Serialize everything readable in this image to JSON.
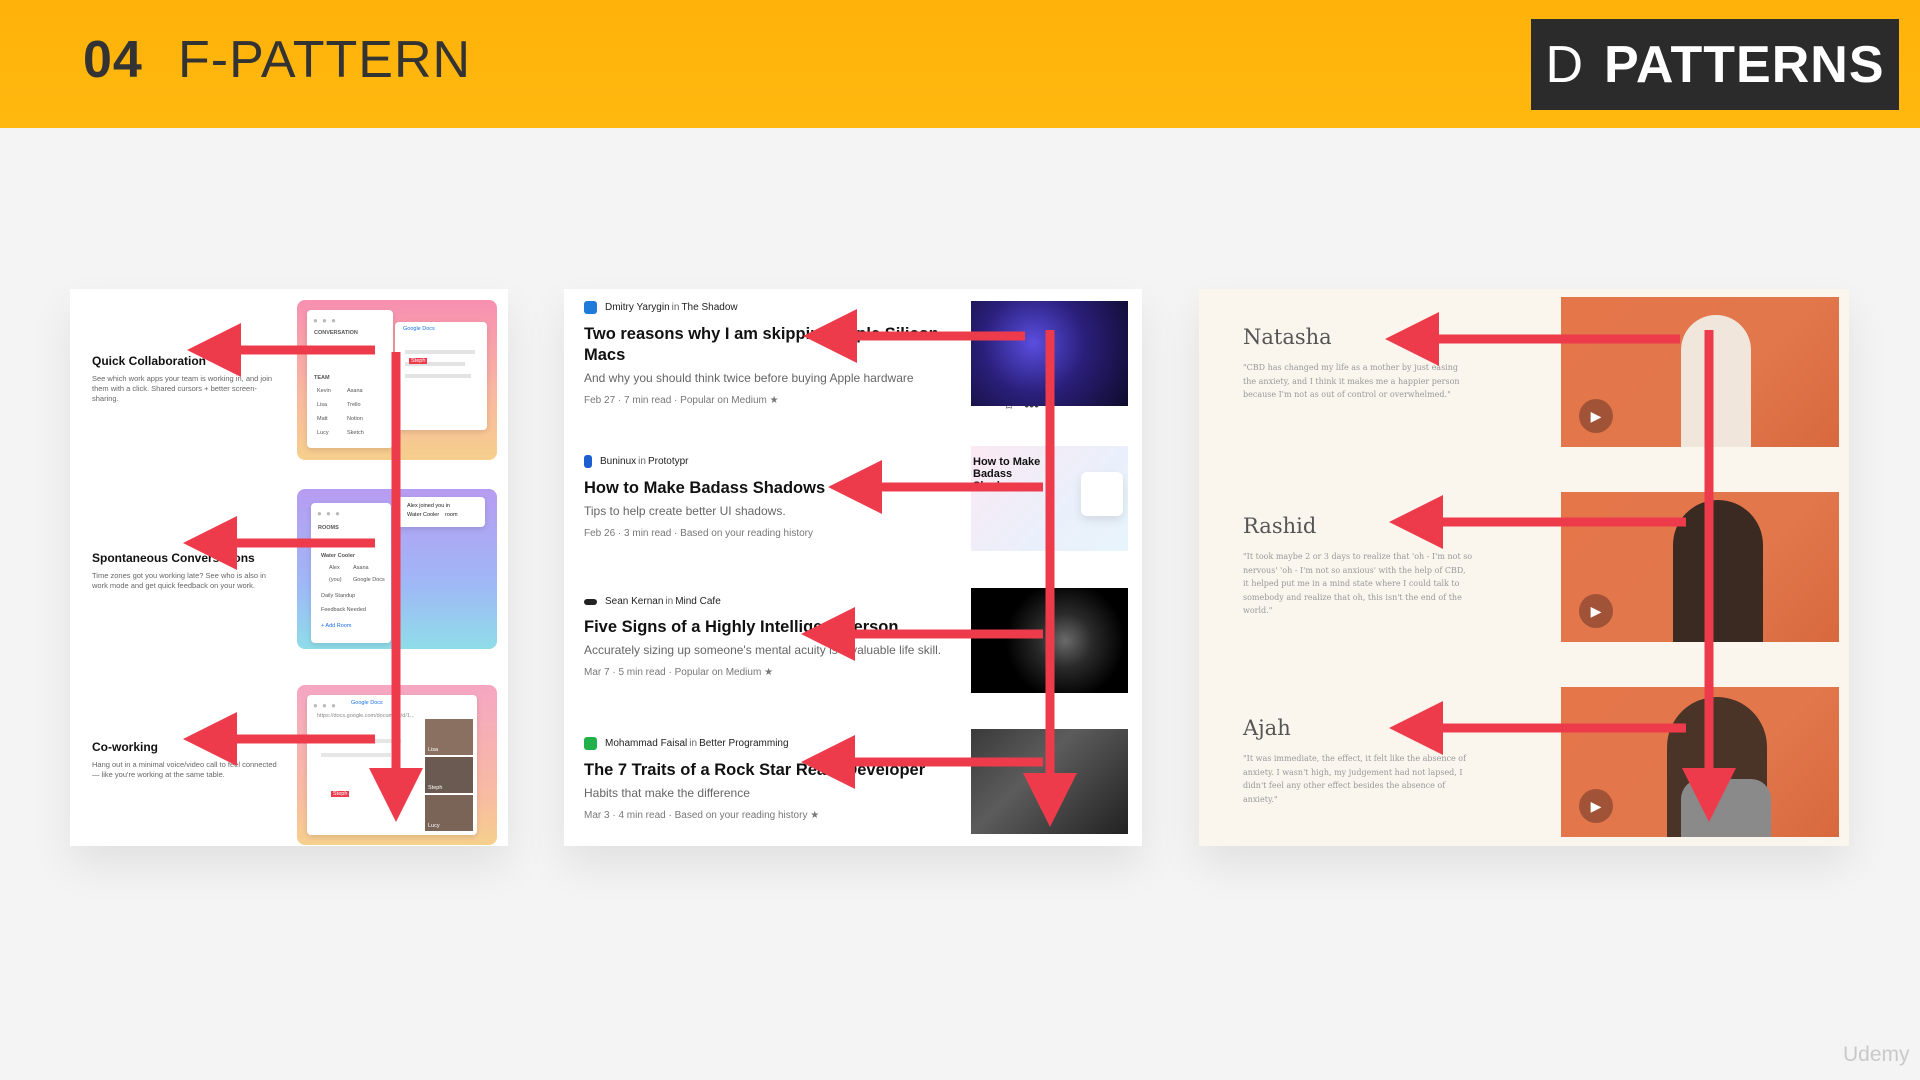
{
  "header": {
    "number": "04",
    "title": "F-PATTERN",
    "brand_d": "D",
    "brand_word": "PATTERNS"
  },
  "watermark": "Udemy",
  "panel1": {
    "features": [
      {
        "title": "Quick Collaboration",
        "text": "See which work apps your team is working in, and join them with a click. Shared cursors + better screen-sharing."
      },
      {
        "title": "Spontaneous Conversations",
        "text": "Time zones got you working late? See who is also in work mode and get quick feedback on your work."
      },
      {
        "title": "Co-working",
        "text": "Hang out in a minimal voice/video call to feel connected — like you're working at the same table."
      }
    ],
    "shot1": {
      "section": "CONVERSATION",
      "you": "(you)",
      "team_label": "TEAM",
      "team": [
        "Kevin",
        "Lisa",
        "Matt",
        "Lucy"
      ],
      "apps": [
        "Asana",
        "Trello",
        "Notion",
        "Sketch"
      ],
      "tab": "Google Docs",
      "cursor": "Steph"
    },
    "shot2": {
      "section": "ROOMS",
      "toast_line1": "Alex joined you in",
      "toast_line2": "Water Cooler",
      "toast_line3": "room",
      "rooms": [
        "Good Morning",
        "Water Cooler",
        "Daily Standup",
        "Feedback Needed"
      ],
      "members": [
        "Alex",
        "(you)"
      ],
      "member_apps": [
        "Asana",
        "Google Docs"
      ],
      "add_room": "+ Add Room"
    },
    "shot3": {
      "tab": "Google Docs",
      "url": "https://docs.google.com/document/d/1...",
      "cursor": "Steph",
      "people": [
        "Lisa",
        "Steph",
        "Lucy"
      ]
    }
  },
  "panel2": {
    "articles": [
      {
        "author": "Dmitry Yarygin",
        "in": "in",
        "pub": "The Shadow",
        "title": "Two reasons why I am skipping Apple Silicon Macs",
        "subtitle": "And why you should think twice before buying Apple hardware",
        "meta": "Feb 27 · 7 min read · Popular on Medium ★",
        "logo_color": "#1e7bd9"
      },
      {
        "author": "Buninux",
        "in": "in",
        "pub": "Prototypr",
        "title": "How to Make Badass Shadows",
        "subtitle": "Tips to help create better UI shadows.",
        "meta": "Feb 26 · 3 min read · Based on your reading history",
        "logo_color": "#1b5fd0",
        "thumb_text": "How to Make Badass Shadows"
      },
      {
        "author": "Sean Kernan",
        "in": "in",
        "pub": "Mind Cafe",
        "title": "Five Signs of a Highly Intelligent Person",
        "subtitle": "Accurately sizing up someone's mental acuity is a valuable life skill.",
        "meta": "Mar 7 · 5 min read · Popular on Medium ★",
        "logo_color": "#222222"
      },
      {
        "author": "Mohammad Faisal",
        "in": "in",
        "pub": "Better Programming",
        "title": "The 7 Traits of a Rock Star React Developer",
        "subtitle": "Habits that make the difference",
        "meta": "Mar 3 · 4 min read · Based on your reading history ★",
        "logo_color": "#22b04b"
      }
    ],
    "bookmark": "⌑",
    "more": "•••"
  },
  "panel3": {
    "testimonials": [
      {
        "name": "Natasha",
        "quote": "\"CBD has changed my life as a mother by just easing the anxiety, and I think it makes me a happier person because I'm not as out of control or overwhelmed.\""
      },
      {
        "name": "Rashid",
        "quote": "\"It took maybe 2 or 3 days to realize that 'oh - I'm not so nervous' 'oh - I'm not so anxious' with the help of CBD, it helped put me in a mind state where I could talk to somebody and realize that oh, this isn't the end of the world.\""
      },
      {
        "name": "Ajah",
        "quote": "\"It was immediate, the effect, it felt like the absence of anxiety. I wasn't high, my judgement had not lapsed, I didn't feel any other effect besides the absence of anxiety.\""
      }
    ],
    "play": "▶"
  },
  "colors": {
    "accent_yellow": "#ffb40c",
    "arrow_red": "#ee3b4b",
    "dark": "#2b2b2b"
  }
}
